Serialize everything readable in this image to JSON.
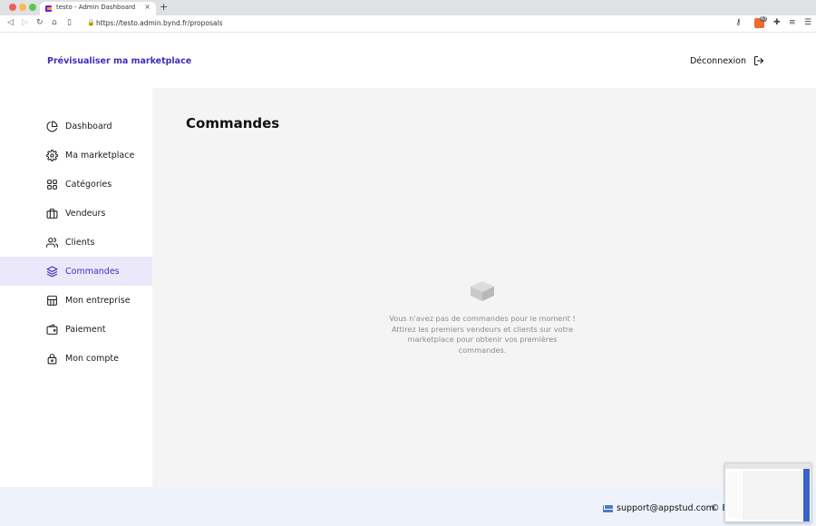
{
  "browser": {
    "tab_title": "testo - Admin Dashboard",
    "tab_close": "×",
    "new_tab": "+",
    "url": "https://testo.admin.bynd.fr/proposals",
    "lock": "🔒",
    "brave_count": "43"
  },
  "header": {
    "preview_label": "Prévisualiser ma marketplace",
    "logout_label": "Déconnexion"
  },
  "sidebar": {
    "items": [
      {
        "label": "Dashboard",
        "icon": "pie-chart-icon"
      },
      {
        "label": "Ma marketplace",
        "icon": "gear-icon"
      },
      {
        "label": "Catégories",
        "icon": "grid-icon"
      },
      {
        "label": "Vendeurs",
        "icon": "briefcase-icon"
      },
      {
        "label": "Clients",
        "icon": "users-icon"
      },
      {
        "label": "Commandes",
        "icon": "layers-icon",
        "active": true
      },
      {
        "label": "Mon entreprise",
        "icon": "building-icon"
      },
      {
        "label": "Paiement",
        "icon": "wallet-icon"
      },
      {
        "label": "Mon compte",
        "icon": "lock-icon"
      }
    ]
  },
  "main": {
    "title": "Commandes",
    "empty_line1": "Vous n'avez pas de commandes pour le moment !",
    "empty_line2": "Attirez les premiers vendeurs et clients sur votre",
    "empty_line3": "marketplace pour obtenir vos premières",
    "empty_line4": "commandes."
  },
  "footer": {
    "support_email": "support@appstud.com",
    "copyright": "© B"
  },
  "colors": {
    "accent": "#3d2fb8",
    "active_bg": "#ece8fb",
    "main_bg": "#f4f4f4",
    "footer_bg": "#eef3fb"
  }
}
